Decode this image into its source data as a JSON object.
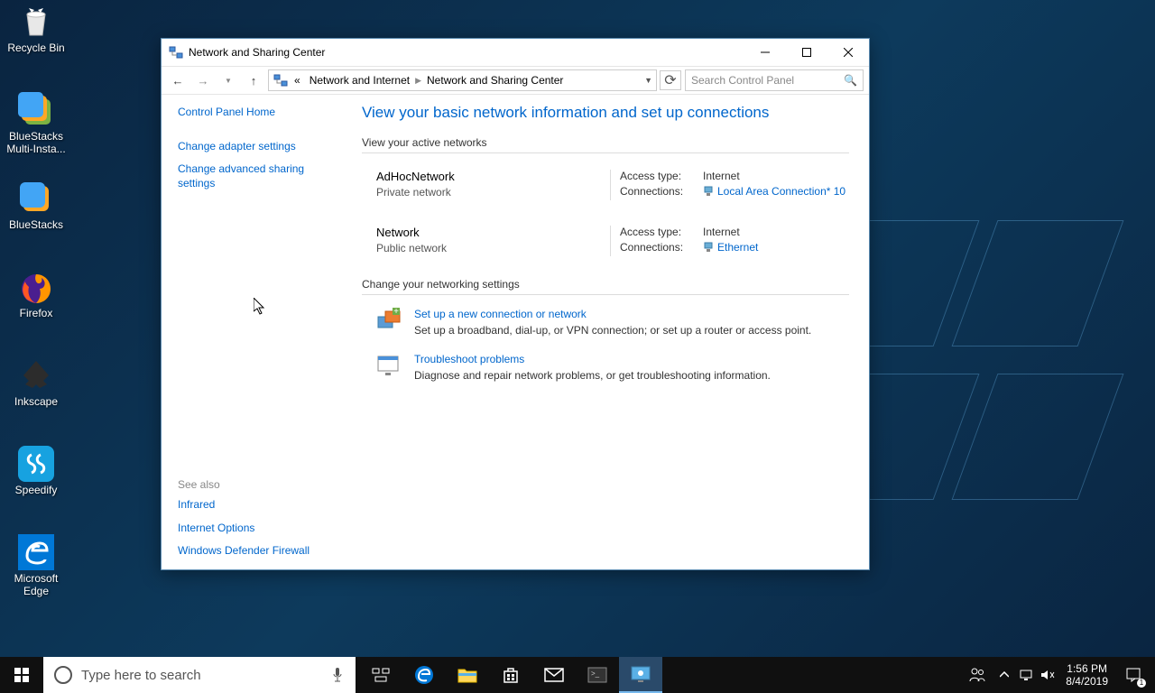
{
  "desktop": {
    "icons": [
      {
        "label": "Recycle Bin"
      },
      {
        "label": "BlueStacks Multi-Insta..."
      },
      {
        "label": "BlueStacks"
      },
      {
        "label": "Firefox"
      },
      {
        "label": "Inkscape"
      },
      {
        "label": "Speedify"
      },
      {
        "label": "Microsoft Edge"
      }
    ]
  },
  "window": {
    "title": "Network and Sharing Center",
    "breadcrumb": {
      "segments": [
        "Network and Internet",
        "Network and Sharing Center"
      ]
    },
    "search_placeholder": "Search Control Panel",
    "sidebar": {
      "home": "Control Panel Home",
      "links": [
        "Change adapter settings",
        "Change advanced sharing settings"
      ],
      "see_also_header": "See also",
      "see_also": [
        "Infrared",
        "Internet Options",
        "Windows Defender Firewall"
      ]
    },
    "main": {
      "title": "View your basic network information and set up connections",
      "active_header": "View your active networks",
      "networks": [
        {
          "name": "AdHocNetwork",
          "type": "Private network",
          "access_label": "Access type:",
          "access_value": "Internet",
          "conn_label": "Connections:",
          "conn_link": "Local Area Connection* 10"
        },
        {
          "name": "Network",
          "type": "Public network",
          "access_label": "Access type:",
          "access_value": "Internet",
          "conn_label": "Connections:",
          "conn_link": "Ethernet"
        }
      ],
      "change_header": "Change your networking settings",
      "settings": [
        {
          "link": "Set up a new connection or network",
          "desc": "Set up a broadband, dial-up, or VPN connection; or set up a router or access point."
        },
        {
          "link": "Troubleshoot problems",
          "desc": "Diagnose and repair network problems, or get troubleshooting information."
        }
      ]
    }
  },
  "taskbar": {
    "search_placeholder": "Type here to search",
    "time": "1:56 PM",
    "date": "8/4/2019"
  }
}
